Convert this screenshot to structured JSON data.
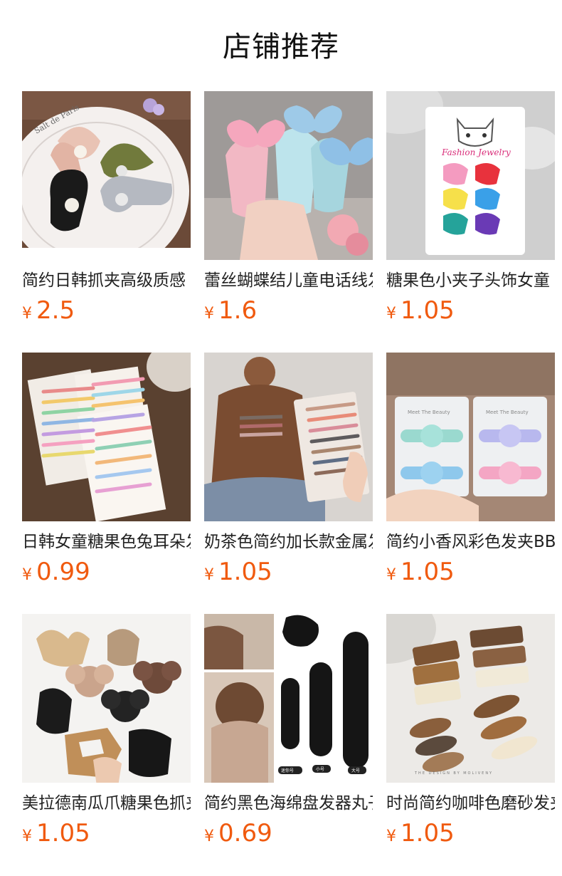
{
  "header": {
    "title": "店铺推荐"
  },
  "currency": "¥",
  "products": [
    {
      "name": "简约日韩抓夹高级质感",
      "price": "2.5",
      "image": "hair-claw-clips-on-plate"
    },
    {
      "name": "蕾丝蝴蝶结儿童电话线发圈",
      "price": "1.6",
      "image": "butterfly-phone-cord-hair-ties"
    },
    {
      "name": "糖果色小夹子头饰女童",
      "price": "1.05",
      "image": "candy-color-mini-claw-card"
    },
    {
      "name": "日韩女童糖果色兔耳朵发夹",
      "price": "0.99",
      "image": "candy-color-bunny-hairpins"
    },
    {
      "name": "奶茶色简约加长款金属发夹",
      "price": "1.05",
      "image": "milk-tea-hairpins-on-model"
    },
    {
      "name": "简约小香风彩色发夹BB夹",
      "price": "1.05",
      "image": "smiley-face-hair-clips"
    },
    {
      "name": "美拉德南瓜爪糖果色抓夹",
      "price": "1.05",
      "image": "maillard-flower-claw-clips"
    },
    {
      "name": "简约黑色海绵盘发器丸子头",
      "price": "0.69",
      "image": "black-sponge-bun-makers"
    },
    {
      "name": "时尚简约咖啡色磨砂发夹",
      "price": "1.05",
      "image": "coffee-matte-snap-clips"
    }
  ],
  "thumbnail_labels": {
    "plate_text": "Salt de Paris",
    "card_text": "Fashion Jewelry",
    "smiley_card_text": "Meet The Beauty",
    "size_small": "迷你号",
    "size_medium": "小号",
    "size_large": "大号",
    "coffee_caption": "THE DESIGN BY MOLIVENY"
  }
}
